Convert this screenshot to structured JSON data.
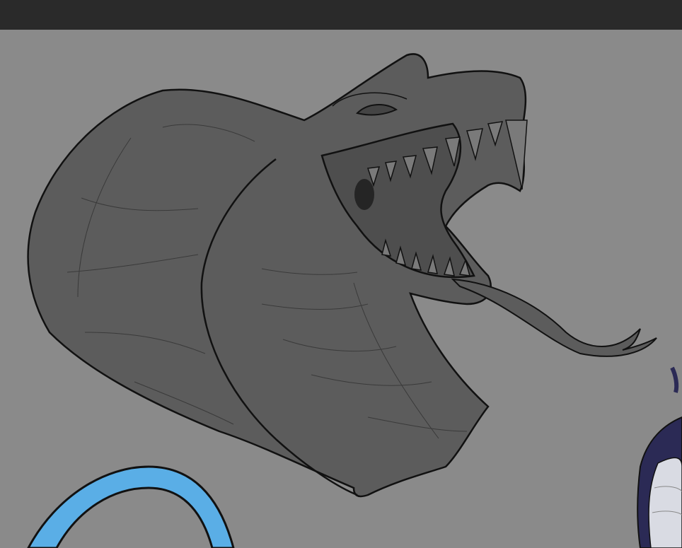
{
  "app": {
    "toolbar": {},
    "canvas": {
      "background_color": "#8a8a8a",
      "artwork": {
        "subject": "serpent-head-sketch",
        "fill_color": "#5c5c5c",
        "line_color": "#111111",
        "accent_blue": "#5aaee6",
        "accent_navy": "#2b2a55"
      }
    }
  }
}
